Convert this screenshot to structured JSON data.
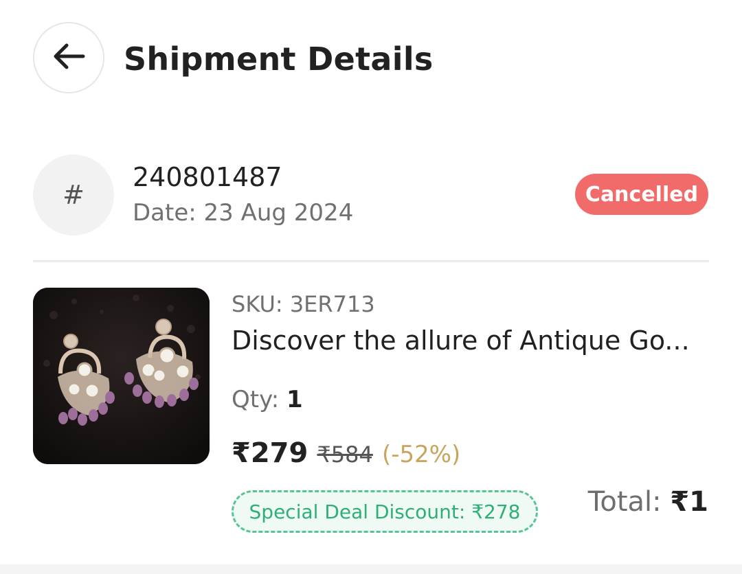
{
  "header": {
    "title": "Shipment Details",
    "back_icon": "arrow-left-icon"
  },
  "order": {
    "hash_symbol": "#",
    "id": "240801487",
    "date": "Date: 23 Aug 2024",
    "status": "Cancelled",
    "status_color": "#f16b6b"
  },
  "product": {
    "sku": "SKU: 3ER713",
    "name": "Discover the allure of Antique Go...",
    "qty_label": "Qty:",
    "qty_value": "1",
    "price": "₹279",
    "original_price": "₹584",
    "discount": "(-52%)",
    "discount_color": "#c9a45c",
    "special_deal": "Special Deal Discount: ₹278",
    "special_deal_color": "#2fae78",
    "image_alt": "earrings-product-image"
  },
  "summary": {
    "total_label": "Total:",
    "total_value": "₹1"
  }
}
